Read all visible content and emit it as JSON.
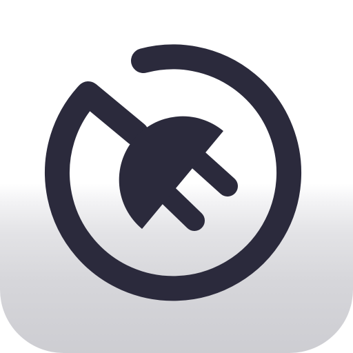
{
  "app_icon": {
    "icon": "plug-disconnect-icon",
    "glyph_color": "#2b2a3c",
    "background_top": "#ffffff",
    "background_bottom": "#cdcdd2"
  }
}
